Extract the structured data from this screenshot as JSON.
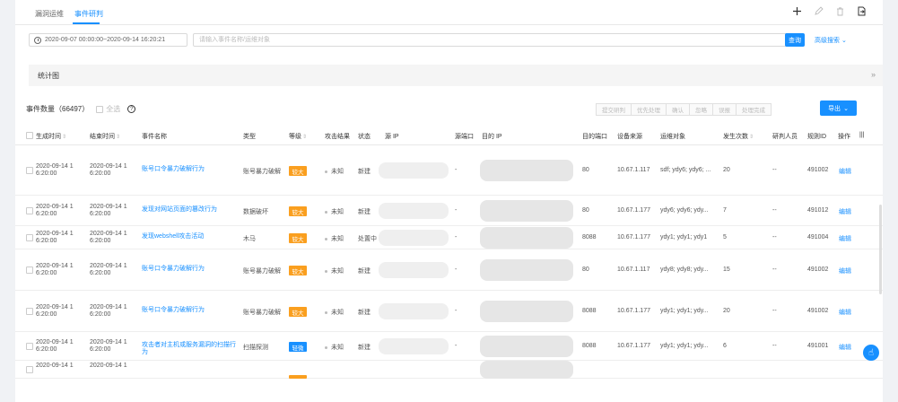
{
  "tabs": [
    {
      "label": "漏洞运维"
    },
    {
      "label": "事件研判"
    }
  ],
  "toolbar": {
    "add_icon": "plus-icon",
    "edit_icon": "pencil-icon",
    "delete_icon": "trash-icon",
    "export_icon": "file-export-icon"
  },
  "filters": {
    "date_range": "2020-09-07 00:00:00~2020-09-14 16:20:21",
    "search_placeholder": "请输入事件名称/运维对象",
    "query_label": "查询",
    "advanced_label": "高级搜索"
  },
  "chart_panel": {
    "label": "统计图"
  },
  "summary": {
    "count_label": "事件数量（66497）",
    "select_all": "全选"
  },
  "actions": [
    "提交研判",
    "优先处理",
    "确认",
    "忽略",
    "误报",
    "处理完成"
  ],
  "export_label": "导出",
  "columns": [
    "生成时间",
    "结束时间",
    "事件名称",
    "类型",
    "等级",
    "攻击结果",
    "状态",
    "源 IP",
    "源端口",
    "目的 IP",
    "目的端口",
    "设备来源",
    "运维对象",
    "发生次数",
    "研判人员",
    "规则ID",
    "操作"
  ],
  "rows": [
    {
      "start": "2020-09-14 16:20:00",
      "end": "2020-09-14 16:20:00",
      "start_a": "2020-09-14 1",
      "start_b": "6:20:00",
      "end_a": "2020-09-14 1",
      "end_b": "6:20:00",
      "name": "账号口令暴力破解行为",
      "type": "账号暴力破解",
      "level": "较大",
      "level_color": "orange",
      "result": "未知",
      "status": "新建",
      "src_port": "-",
      "dst_port": "80",
      "device": "10.67.1.117",
      "target": "sdf; ydy6; ydy6; ...",
      "count": "20",
      "analyst": "--",
      "rule": "491002",
      "op": "编辑"
    },
    {
      "start": "",
      "end": "",
      "start_a": "2020-09-14 1",
      "start_b": "6:20:00",
      "end_a": "2020-09-14 1",
      "end_b": "6:20:00",
      "name": "发现对网站页面的篡改行为",
      "type": "数据破坏",
      "level": "较大",
      "level_color": "orange",
      "result": "未知",
      "status": "新建",
      "src_port": "-",
      "dst_port": "80",
      "device": "10.67.1.177",
      "target": "ydy6; ydy6; ydy...",
      "count": "7",
      "analyst": "--",
      "rule": "491012",
      "op": "编辑"
    },
    {
      "start": "",
      "end": "",
      "start_a": "2020-09-14 1",
      "start_b": "6:20:00",
      "end_a": "2020-09-14 1",
      "end_b": "6:20:00",
      "name": "发现webshell攻击活动",
      "type": "木马",
      "level": "较大",
      "level_color": "orange",
      "result": "未知",
      "status": "处置中",
      "src_port": "-",
      "dst_port": "8088",
      "device": "10.67.1.177",
      "target": "ydy1; ydy1; ydy1",
      "count": "5",
      "analyst": "--",
      "rule": "491004",
      "op": "编辑"
    },
    {
      "start": "",
      "end": "",
      "start_a": "2020-09-14 1",
      "start_b": "6:20:00",
      "end_a": "2020-09-14 1",
      "end_b": "6:20:00",
      "name": "账号口令暴力破解行为",
      "type": "账号暴力破解",
      "level": "较大",
      "level_color": "orange",
      "result": "未知",
      "status": "新建",
      "src_port": "-",
      "dst_port": "80",
      "device": "10.67.1.117",
      "target": "ydy8; ydy8; ydy...",
      "count": "15",
      "analyst": "--",
      "rule": "491002",
      "op": "编辑"
    },
    {
      "start": "",
      "end": "",
      "start_a": "2020-09-14 1",
      "start_b": "6:20:00",
      "end_a": "2020-09-14 1",
      "end_b": "6:20:00",
      "name": "账号口令暴力破解行为",
      "type": "账号暴力破解",
      "level": "较大",
      "level_color": "orange",
      "result": "未知",
      "status": "新建",
      "src_port": "-",
      "dst_port": "8088",
      "device": "10.67.1.177",
      "target": "ydy1; ydy1; ydy...",
      "count": "20",
      "analyst": "--",
      "rule": "491002",
      "op": "编辑"
    },
    {
      "start": "",
      "end": "",
      "start_a": "2020-09-14 1",
      "start_b": "6:20:00",
      "end_a": "2020-09-14 1",
      "end_b": "6:20:00",
      "name": "攻击者对主机或服务漏洞的扫描行为",
      "type": "扫描探测",
      "level": "轻微",
      "level_color": "blue",
      "result": "未知",
      "status": "新建",
      "src_port": "-",
      "dst_port": "8088",
      "device": "10.67.1.177",
      "target": "ydy1; ydy1; ydy...",
      "count": "6",
      "analyst": "--",
      "rule": "491001",
      "op": "编辑"
    },
    {
      "start": "",
      "end": "",
      "start_a": "2020-09-14 1",
      "start_b": "",
      "end_a": "2020-09-14 1",
      "end_b": ""
    }
  ],
  "colors": {
    "accent": "#1890ff",
    "level_major": "#fa9f1f",
    "level_minor": "#1890ff"
  }
}
